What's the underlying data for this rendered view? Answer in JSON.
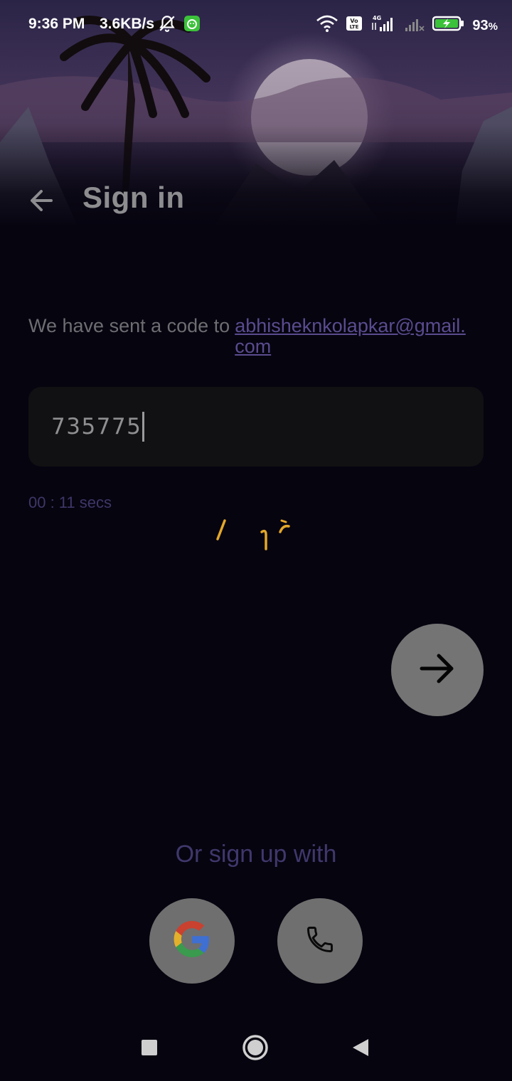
{
  "status_bar": {
    "time": "9:36 PM",
    "network_speed": "3.6KB/s",
    "battery_percent": "93",
    "battery_unit": "%",
    "icons": [
      "mute-icon",
      "app-notification-icon",
      "wifi-icon",
      "volte-icon",
      "signal-4g-icon",
      "signal-icon",
      "battery-charging-icon"
    ]
  },
  "header": {
    "title": "Sign in",
    "back_icon": "arrow-left-icon"
  },
  "verification": {
    "sent_prefix": "We have sent a code to",
    "email": "abhisheknkolapkar@gmail.com",
    "code_value": "735775",
    "timer": "00 : 11 secs"
  },
  "actions": {
    "next_icon": "arrow-right-icon",
    "or_text": "Or sign up with",
    "social": [
      "google-icon",
      "phone-icon"
    ]
  },
  "colors": {
    "background": "#06040f",
    "accent": "#5a4c8f",
    "button": "#747474",
    "loader": "#f2b32b"
  },
  "nav_bar": {
    "items": [
      "recents-icon",
      "home-icon",
      "back-icon"
    ]
  }
}
